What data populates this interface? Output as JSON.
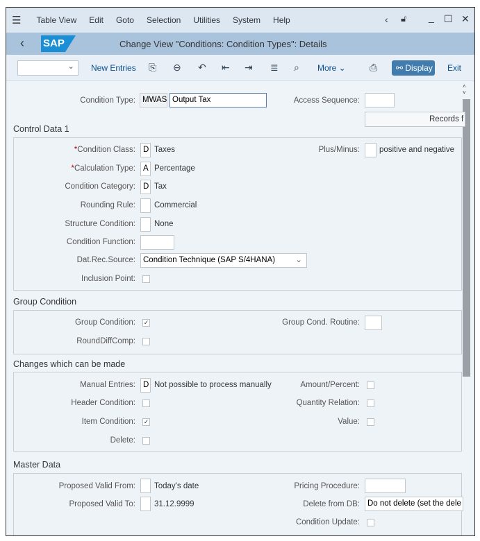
{
  "menu": {
    "items": [
      "Table View",
      "Edit",
      "Goto",
      "Selection",
      "Utilities",
      "System",
      "Help"
    ]
  },
  "title": "Change View \"Conditions: Condition Types\": Details",
  "logo": "SAP",
  "toolbar": {
    "new_entries": "New Entries",
    "more": "More",
    "display": "Display",
    "exit": "Exit"
  },
  "header": {
    "condition_type_label": "Condition Type:",
    "condition_type": "MWAS",
    "condition_type_desc": "Output Tax",
    "access_sequence_label": "Access Sequence:",
    "access_sequence": "",
    "records_button": "Records f"
  },
  "control_data": {
    "title": "Control Data 1",
    "condition_class_label": "Condition Class:",
    "condition_class": "D",
    "condition_class_text": "Taxes",
    "plus_minus_label": "Plus/Minus:",
    "plus_minus_text": "positive and negative",
    "calculation_type_label": "Calculation Type:",
    "calculation_type": "A",
    "calculation_type_text": "Percentage",
    "condition_category_label": "Condition Category:",
    "condition_category": "D",
    "condition_category_text": "Tax",
    "rounding_rule_label": "Rounding Rule:",
    "rounding_rule_text": "Commercial",
    "structure_condition_label": "Structure Condition:",
    "structure_condition_text": "None",
    "condition_function_label": "Condition Function:",
    "data_source_label": "Dat.Rec.Source:",
    "data_source": "Condition Technique (SAP S/4HANA)",
    "inclusion_point_label": "Inclusion Point:",
    "inclusion_point": false
  },
  "group_condition": {
    "title": "Group Condition",
    "group_condition_label": "Group Condition:",
    "group_condition": true,
    "routine_label": "Group Cond. Routine:",
    "rounddiff_label": "RoundDiffComp:",
    "rounddiff": false
  },
  "changes": {
    "title": "Changes which can be made",
    "manual_entries_label": "Manual Entries:",
    "manual_entries": "D",
    "manual_entries_text": "Not possible to process manually",
    "amount_percent_label": "Amount/Percent:",
    "amount_percent": false,
    "header_condition_label": "Header Condition:",
    "header_condition": false,
    "quantity_relation_label": "Quantity Relation:",
    "quantity_relation": false,
    "item_condition_label": "Item Condition:",
    "item_condition": true,
    "value_label": "Value:",
    "value": false,
    "delete_label": "Delete:",
    "delete": false
  },
  "master_data": {
    "title": "Master Data",
    "valid_from_label": "Proposed Valid From:",
    "valid_from_text": "Today's date",
    "pricing_procedure_label": "Pricing Procedure:",
    "valid_to_label": "Proposed Valid To:",
    "valid_to_text": "31.12.9999",
    "delete_db_label": "Delete from DB:",
    "delete_db": "Do not delete (set the dele",
    "condition_update_label": "Condition Update:",
    "condition_update": false
  },
  "colors": {
    "accent": "#427cac",
    "titlebar": "#a9c3dc",
    "menubar": "#dce7f2"
  }
}
